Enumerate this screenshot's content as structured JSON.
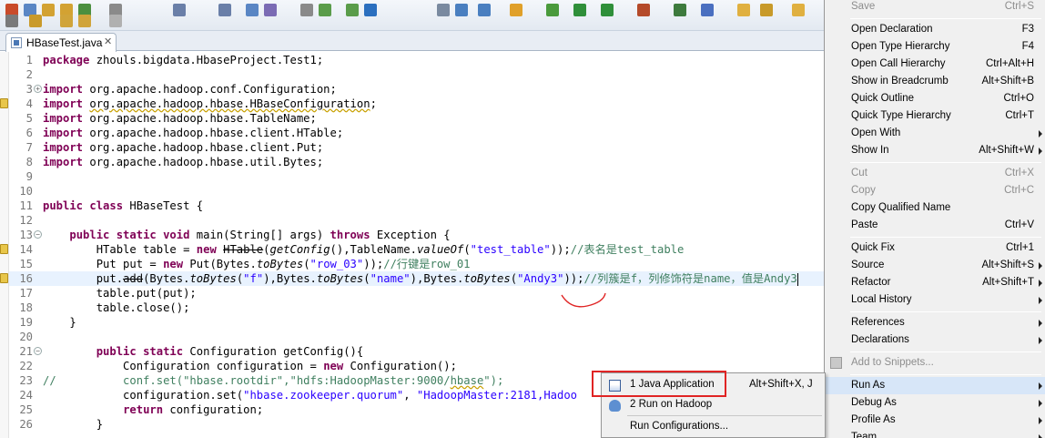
{
  "toolbar": {
    "icons": [
      "new-icon",
      "save-icon",
      "print-icon",
      "debug-icon",
      "run-icon",
      "external-tools-icon",
      "search-icon",
      "back-icon",
      "forward-icon"
    ]
  },
  "editor": {
    "tab": {
      "label": "HBaseTest.java",
      "close": "✕"
    },
    "lines": [
      {
        "n": "1",
        "html": "<span class='kw'>package</span> zhouls.bigdata.HbaseProject.Test1;"
      },
      {
        "n": "2",
        "html": ""
      },
      {
        "n": "3",
        "html": "<span class='kw'>import</span> org.apache.hadoop.conf.Configuration;"
      },
      {
        "n": "4",
        "html": "<span class='kw'>import</span> <span class='warn'>org.apache.hadoop.hbase.HBaseConfiguration</span>;"
      },
      {
        "n": "5",
        "html": "<span class='kw'>import</span> org.apache.hadoop.hbase.TableName;"
      },
      {
        "n": "6",
        "html": "<span class='kw'>import</span> org.apache.hadoop.hbase.client.HTable;"
      },
      {
        "n": "7",
        "html": "<span class='kw'>import</span> org.apache.hadoop.hbase.client.Put;"
      },
      {
        "n": "8",
        "html": "<span class='kw'>import</span> org.apache.hadoop.hbase.util.Bytes;"
      },
      {
        "n": "9",
        "html": ""
      },
      {
        "n": "10",
        "html": ""
      },
      {
        "n": "11",
        "html": "<span class='kw'>public class</span> HBaseTest {"
      },
      {
        "n": "12",
        "html": ""
      },
      {
        "n": "13",
        "html": "    <span class='kw'>public static void</span> main(String[] args) <span class='kw'>throws</span> Exception {"
      },
      {
        "n": "14",
        "html": "        HTable table = <span class='kw'>new</span> <span class='strike'>HTable</span>(<span class='it'>getConfig</span>(),TableName.<span class='it'>valueOf</span>(<span class='str'>\"test_table\"</span>));<span class='cm'>//表名是test_table</span>"
      },
      {
        "n": "15",
        "html": "        Put put = <span class='kw'>new</span> Put(Bytes.<span class='it'>toBytes</span>(<span class='str'>\"row_03\"</span>));<span class='cm'>//行键是row_01</span>"
      },
      {
        "n": "16",
        "html": "        put.<span class='strike'>add</span>(Bytes.<span class='it'>toBytes</span>(<span class='str'>\"f\"</span>),Bytes.<span class='it'>toBytes</span>(<span class='str'>\"name\"</span>),Bytes.<span class='it'>toBytes</span>(<span class='str'>\"Andy3\"</span>));<span class='cm'>//列簇是f，列修饰符是name，值是Andy3</span><span class='caret'></span>"
      },
      {
        "n": "17",
        "html": "        table.put(put);"
      },
      {
        "n": "18",
        "html": "        table.close();"
      },
      {
        "n": "19",
        "html": "    }"
      },
      {
        "n": "20",
        "html": ""
      },
      {
        "n": "21",
        "html": "        <span class='kw'>public static</span> Configuration getConfig(){"
      },
      {
        "n": "22",
        "html": "            Configuration configuration = <span class='kw'>new</span> Configuration();"
      },
      {
        "n": "23",
        "html": "<span class='cm'>//          conf.set(\"hbase.rootdir\",\"hdfs:HadoopMaster:9000/<span class='warn'>hbase</span>\");</span>"
      },
      {
        "n": "24",
        "html": "            configuration.set(<span class='str'>\"hbase.zookeeper.quorum\"</span>, <span class='str'>\"HadoopMaster:2181,Hadoo</span>"
      },
      {
        "n": "25",
        "html": "            <span class='kw'>return</span> configuration;"
      },
      {
        "n": "26",
        "html": "        }"
      }
    ]
  },
  "context_menu": {
    "items": [
      {
        "label": "Save",
        "shortcut": "Ctrl+S",
        "disabled": true
      },
      {
        "sep": true
      },
      {
        "label": "Open Declaration",
        "shortcut": "F3"
      },
      {
        "label": "Open Type Hierarchy",
        "shortcut": "F4"
      },
      {
        "label": "Open Call Hierarchy",
        "shortcut": "Ctrl+Alt+H"
      },
      {
        "label": "Show in Breadcrumb",
        "shortcut": "Alt+Shift+B"
      },
      {
        "label": "Quick Outline",
        "shortcut": "Ctrl+O"
      },
      {
        "label": "Quick Type Hierarchy",
        "shortcut": "Ctrl+T"
      },
      {
        "label": "Open With",
        "shortcut": "",
        "submenu": true
      },
      {
        "label": "Show In",
        "shortcut": "Alt+Shift+W",
        "submenu": true
      },
      {
        "sep": true
      },
      {
        "label": "Cut",
        "shortcut": "Ctrl+X",
        "disabled": true
      },
      {
        "label": "Copy",
        "shortcut": "Ctrl+C",
        "disabled": true
      },
      {
        "label": "Copy Qualified Name",
        "shortcut": ""
      },
      {
        "label": "Paste",
        "shortcut": "Ctrl+V"
      },
      {
        "sep": true
      },
      {
        "label": "Quick Fix",
        "shortcut": "Ctrl+1"
      },
      {
        "label": "Source",
        "shortcut": "Alt+Shift+S",
        "submenu": true
      },
      {
        "label": "Refactor",
        "shortcut": "Alt+Shift+T",
        "submenu": true
      },
      {
        "label": "Local History",
        "shortcut": "",
        "submenu": true
      },
      {
        "sep": true
      },
      {
        "label": "References",
        "shortcut": "",
        "submenu": true
      },
      {
        "label": "Declarations",
        "shortcut": "",
        "submenu": true
      },
      {
        "sep": true
      },
      {
        "label": "Add to Snippets...",
        "shortcut": "",
        "disabled": true
      },
      {
        "sep": true
      },
      {
        "label": "Run As",
        "shortcut": "",
        "submenu": true,
        "selected": true
      },
      {
        "label": "Debug As",
        "shortcut": "",
        "submenu": true
      },
      {
        "label": "Profile As",
        "shortcut": "",
        "submenu": true
      },
      {
        "label": "Team",
        "shortcut": "",
        "submenu": true
      }
    ]
  },
  "run_as_submenu": {
    "items": [
      {
        "label": "1 Java Application",
        "shortcut": "Alt+Shift+X, J",
        "icon": "java-app-icon"
      },
      {
        "label": "2 Run on Hadoop",
        "shortcut": "",
        "icon": "hadoop-elephant-icon"
      },
      {
        "label": "Run Configurations...",
        "shortcut": "",
        "icon": ""
      }
    ]
  },
  "colors": {
    "keyword": "#7f0055",
    "string": "#2a00ff",
    "comment": "#3f7f5f",
    "annotation": "#e02424"
  }
}
